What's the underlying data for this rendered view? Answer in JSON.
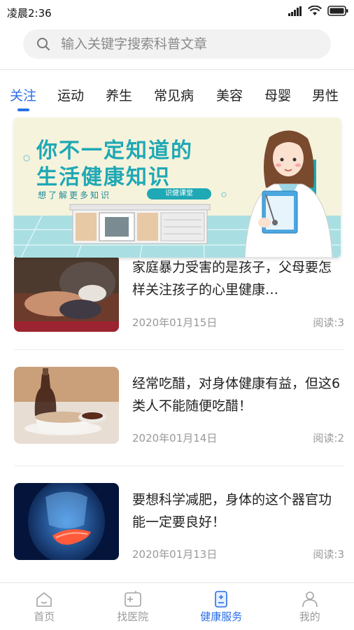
{
  "status_bar": {
    "time": "凌晨2:36"
  },
  "search": {
    "placeholder": "输入关键字搜索科普文章"
  },
  "tabs": [
    {
      "label": "关注",
      "active": true
    },
    {
      "label": "运动"
    },
    {
      "label": "养生"
    },
    {
      "label": "常见病"
    },
    {
      "label": "美容"
    },
    {
      "label": "母婴"
    },
    {
      "label": "男性"
    }
  ],
  "banner": {
    "title_line1": "你不一定知道的",
    "title_line2": "生活健康知识",
    "subtitle": "想了解更多知识",
    "button_label": "识健课堂"
  },
  "articles": [
    {
      "title": "家庭暴力受害的是孩子，父母要怎样关注孩子的心里健康…",
      "date": "2020年01月15日",
      "reads": "阅读:3"
    },
    {
      "title": "经常吃醋，对身体健康有益，但这6类人不能随便吃醋！",
      "date": "2020年01月14日",
      "reads": "阅读:2"
    },
    {
      "title": "要想科学减肥，身体的这个器官功能一定要良好！",
      "date": "2020年01月13日",
      "reads": "阅读:3"
    }
  ],
  "bottom_nav": [
    {
      "label": "首页",
      "icon": "home-icon"
    },
    {
      "label": "找医院",
      "icon": "hospital-icon"
    },
    {
      "label": "健康服务",
      "icon": "health-service-icon",
      "active": true
    },
    {
      "label": "我的",
      "icon": "profile-icon"
    }
  ],
  "colors": {
    "accent": "#2a6ee8",
    "banner_teal": "#1fa8b5",
    "text": "#222222",
    "muted": "#999999"
  }
}
